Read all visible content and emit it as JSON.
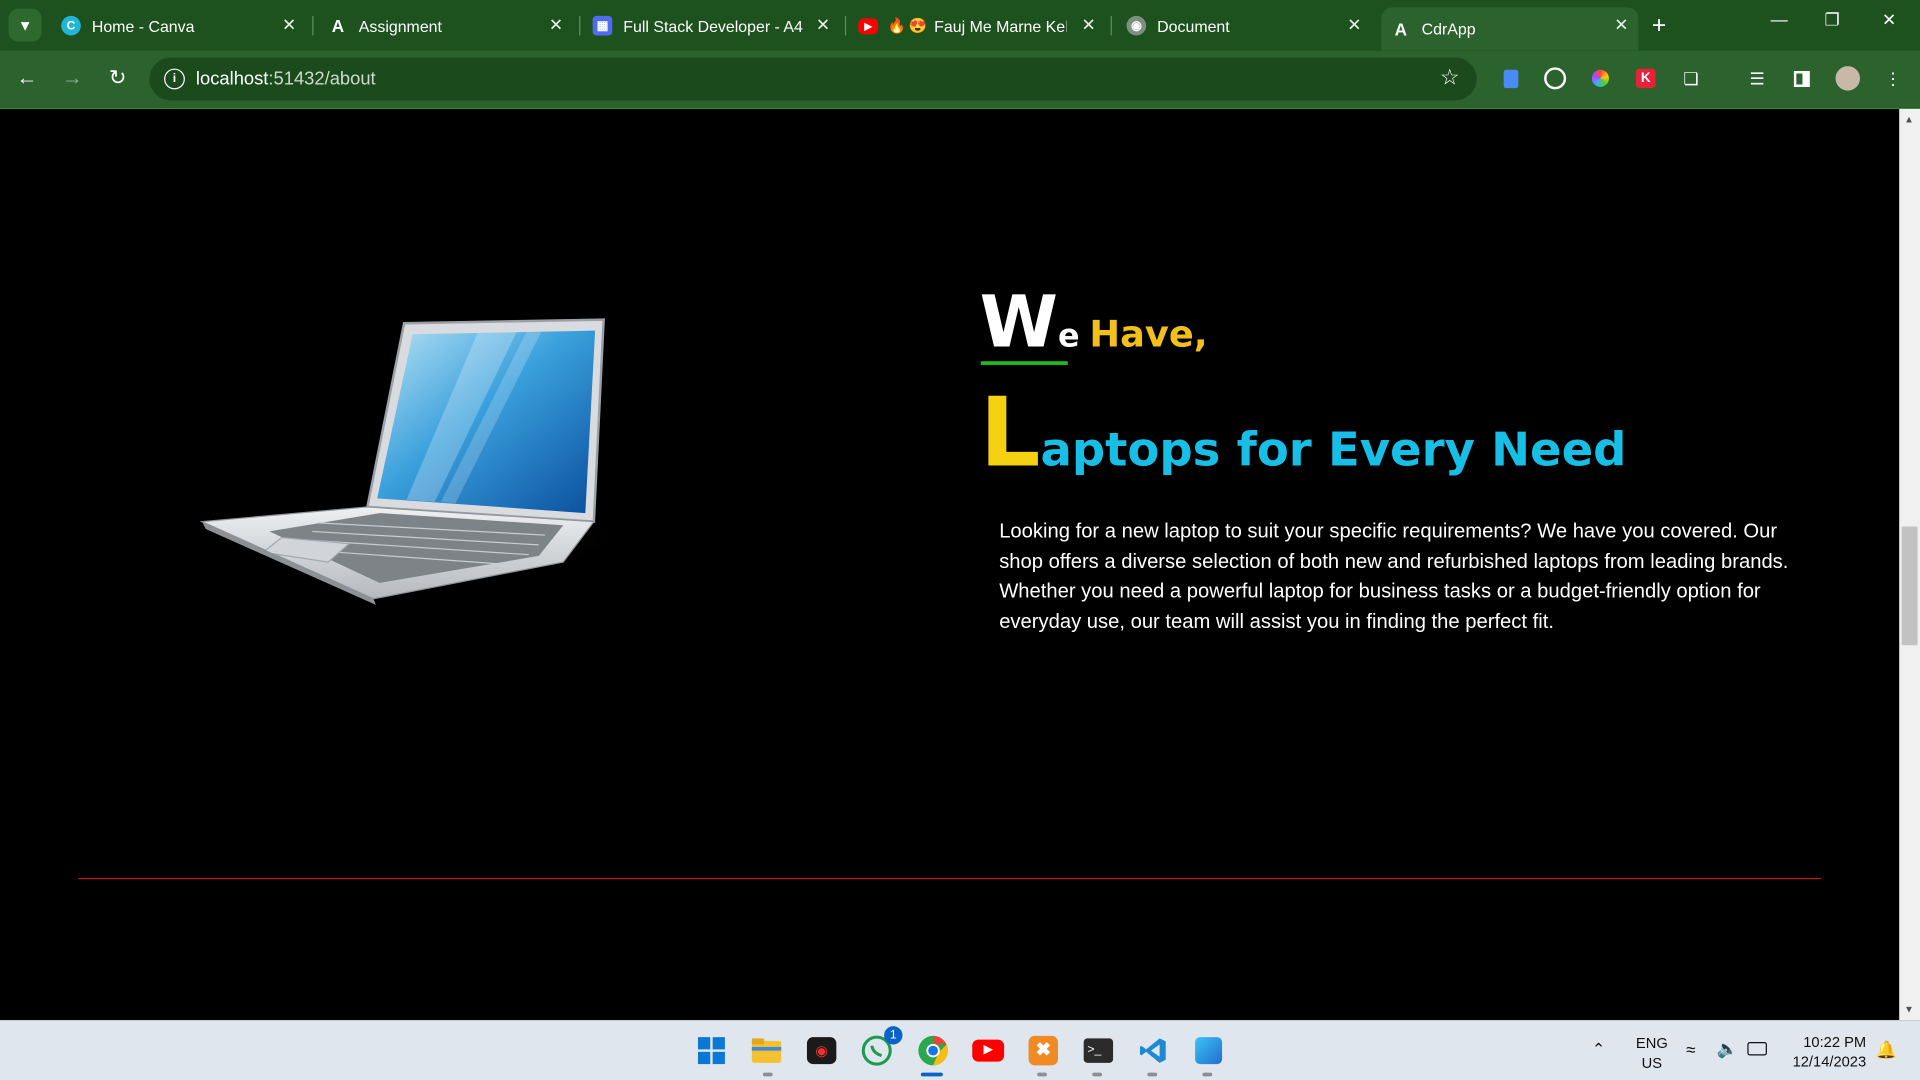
{
  "browser": {
    "tabs": [
      {
        "title": "Home - Canva",
        "favicon": "canva-icon"
      },
      {
        "title": "Assignment",
        "favicon": "angular-icon"
      },
      {
        "title": "Full Stack Developer - A4",
        "favicon": "document-icon"
      },
      {
        "title": "Fauj Me Marne Keliye",
        "favicon": "youtube-icon"
      },
      {
        "title": "Document",
        "favicon": "globe-icon"
      },
      {
        "title": "CdrApp",
        "favicon": "angular-icon",
        "active": true
      }
    ],
    "url_host": "localhost",
    "url_path": ":51432/about"
  },
  "page": {
    "heading1_w": "W",
    "heading1_e": "e",
    "heading1_rest": "Have,",
    "heading2_l": "L",
    "heading2_rest": "aptops for Every Need",
    "paragraph": "Looking for a new laptop to suit your specific requirements? We have you covered. Our shop offers a diverse selection of both new and refurbished laptops from leading brands. Whether you need a powerful laptop for business tasks or a budget-friendly option for everyday use, our team will assist you in finding the perfect fit."
  },
  "taskbar": {
    "whatsapp_badge": "1",
    "language": "ENG",
    "region": "US",
    "time": "10:22 PM",
    "date": "12/14/2023"
  },
  "colors": {
    "browser_frame": "#1d521f",
    "toolbar": "#2c622d",
    "accent_yellow": "#f3c019",
    "accent_cyan": "#17bfe6",
    "underline_green": "#1ec01e",
    "divider_red": "#c8161b"
  }
}
